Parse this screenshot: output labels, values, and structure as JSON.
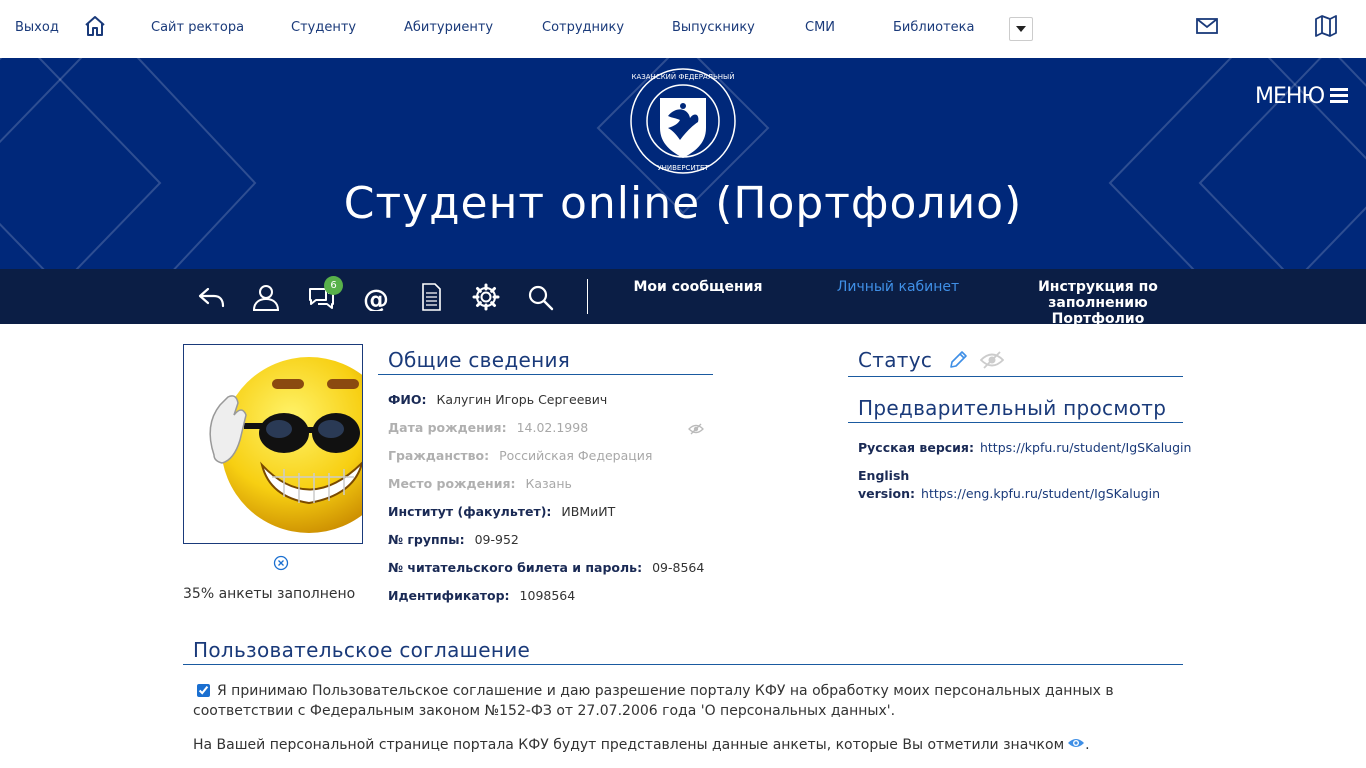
{
  "topbar": {
    "logout": "Выход",
    "links": [
      "Сайт ректора",
      "Студенту",
      "Абитуриенту",
      "Сотруднику",
      "Выпускнику",
      "СМИ",
      "Библиотека"
    ]
  },
  "banner": {
    "title": "Студент online (Портфолио)",
    "menu_label": "МЕНЮ"
  },
  "nav": {
    "messages_badge": "6",
    "links": [
      "Мои сообщения",
      "Личный кабинет",
      "Инструкция по заполнению Портфолио"
    ]
  },
  "profile": {
    "filled_text": "35% анкеты заполнено"
  },
  "general": {
    "heading": "Общие сведения",
    "rows": [
      {
        "label": "ФИО:",
        "value": "Калугин Игорь Сергеевич"
      },
      {
        "label": "Дата рождения:",
        "value": "14.02.1998"
      },
      {
        "label": "Гражданство:",
        "value": "Российская Федерация"
      },
      {
        "label": "Место рождения:",
        "value": "Казань"
      },
      {
        "label": "Институт (факультет):",
        "value": "ИВМиИТ"
      },
      {
        "label": "№ группы:",
        "value": "09-952"
      },
      {
        "label": "№ читательского билета и пароль:",
        "value": "09-8564"
      },
      {
        "label": "Идентификатор:",
        "value": "1098564"
      }
    ]
  },
  "status": {
    "heading": "Статус"
  },
  "preview": {
    "heading": "Предварительный просмотр",
    "ru_label": "Русская версия:",
    "ru_link": "https://kpfu.ru/student/IgSKalugin",
    "en_label_1": "English",
    "en_label_2": "version:",
    "en_link": "https://eng.kpfu.ru/student/IgSKalugin"
  },
  "agreement": {
    "heading": "Пользовательское соглашение",
    "text": "Я принимаю Пользовательское соглашение и даю разрешение порталу КФУ на обработку моих персональных данных в соответствии с Федеральным законом №152-ФЗ от 27.07.2006 года 'О персональных данных'.",
    "note": "На Вашей персональной странице портала КФУ будут представлены данные анкеты, которые Вы отметили значком",
    "note_end": "."
  }
}
